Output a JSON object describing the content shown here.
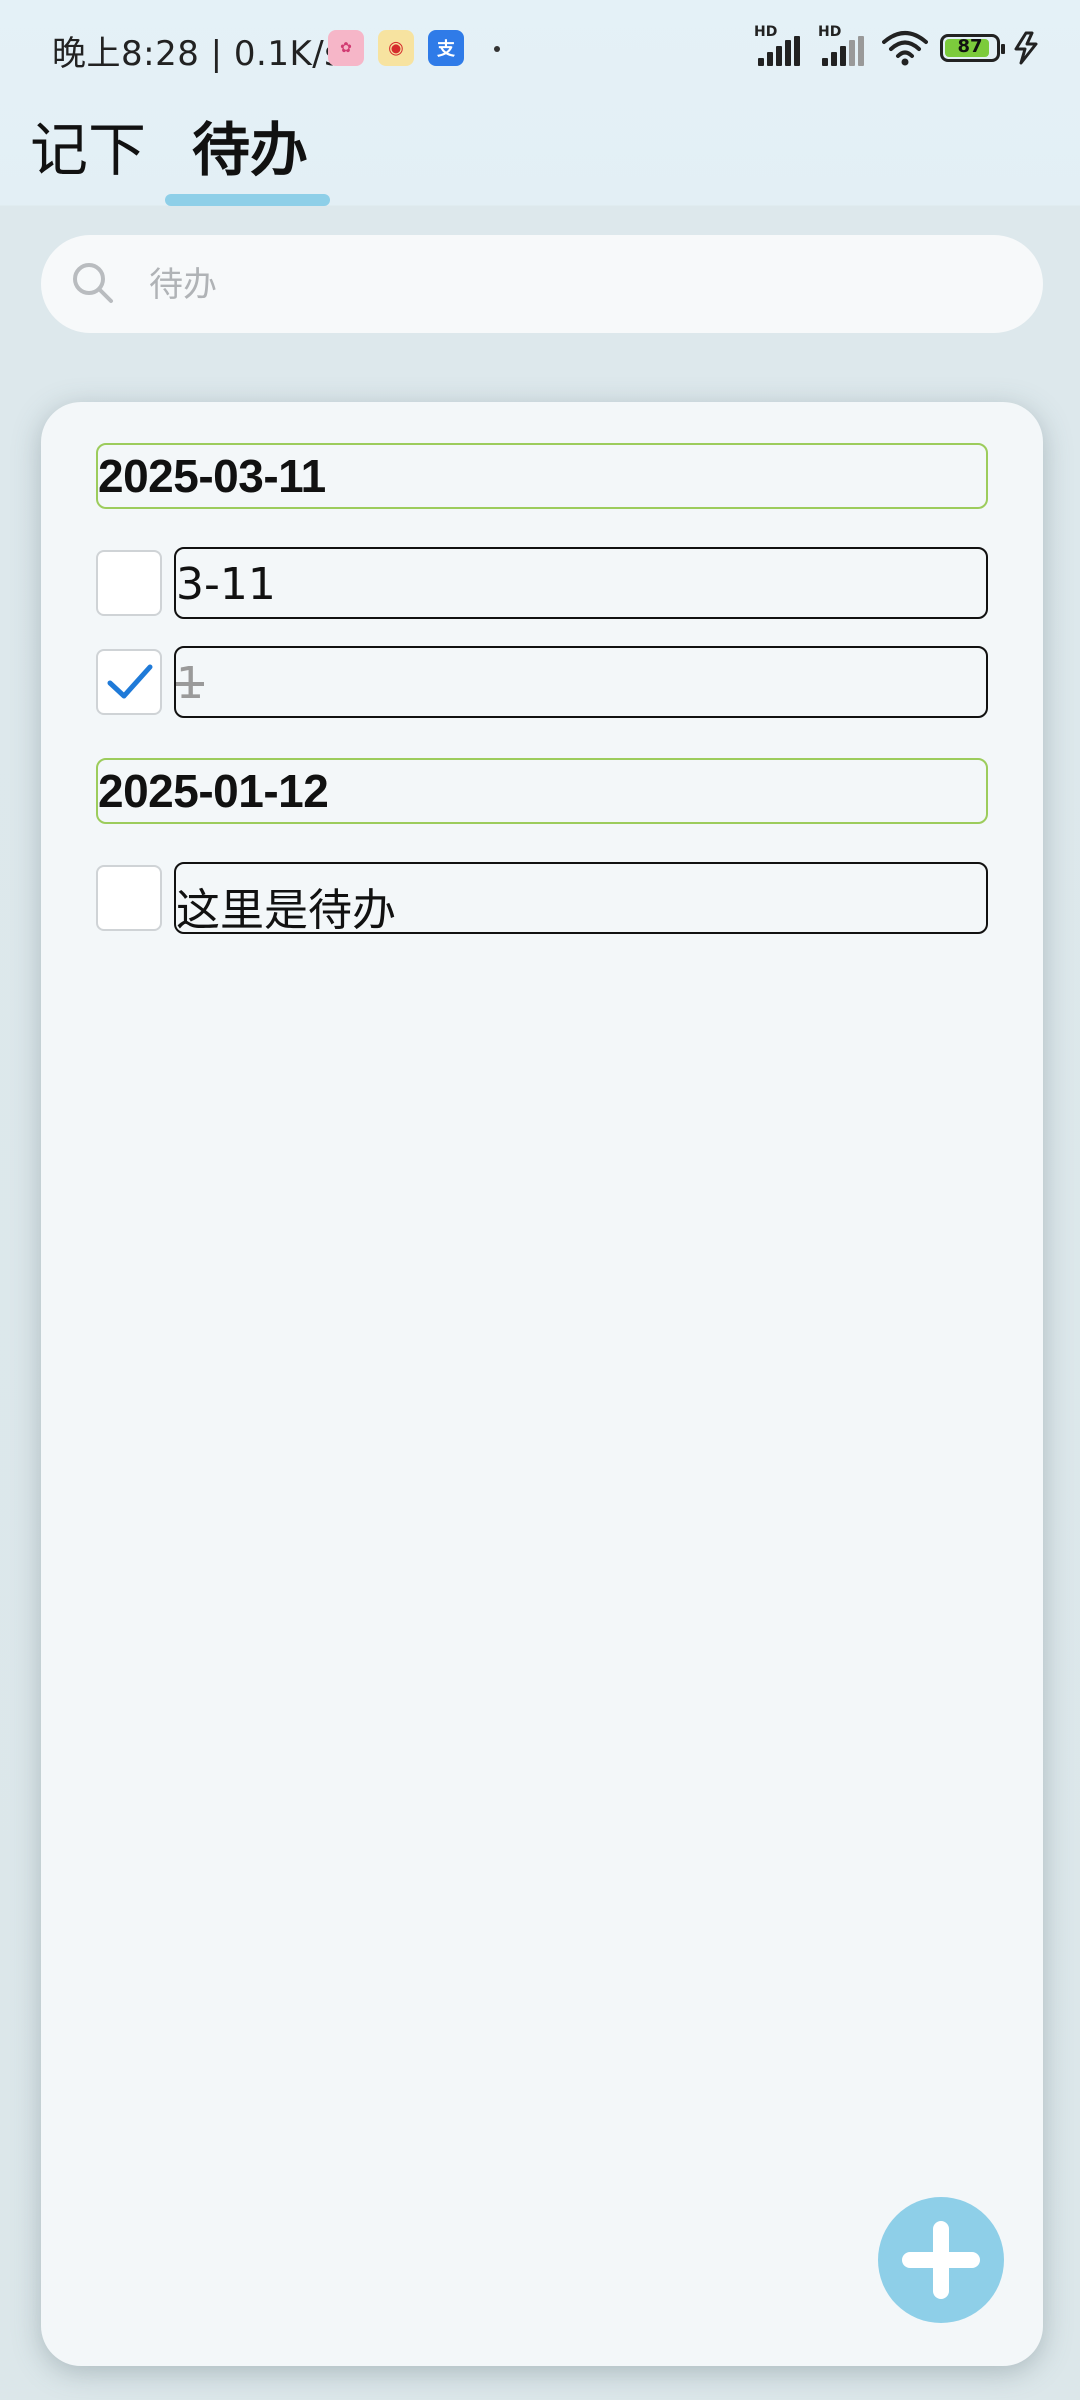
{
  "status_bar": {
    "time_speed": "晚上8:28 | 0.1K/s",
    "network_label_1": "HD",
    "network_label_2": "HD",
    "battery_level": "87",
    "icons": [
      "pink-app-icon",
      "weibo-icon",
      "alipay-icon",
      "dot",
      "signal-icon",
      "signal-icon",
      "wifi-icon",
      "battery-icon",
      "charging-icon"
    ]
  },
  "tabs": [
    {
      "label": "记下",
      "active": false
    },
    {
      "label": "待办",
      "active": true
    }
  ],
  "search": {
    "placeholder": "待办",
    "value": ""
  },
  "todo_groups": [
    {
      "date": "2025-03-11",
      "items": [
        {
          "text": "3-11",
          "checked": false
        },
        {
          "text": "1",
          "checked": true
        }
      ]
    },
    {
      "date": "2025-01-12",
      "items": [
        {
          "text": "这里是待办",
          "checked": false
        }
      ]
    }
  ],
  "fab": {
    "icon": "plus-icon"
  },
  "colors": {
    "accent": "#8ecfe8",
    "date_border": "#9ccc5c",
    "check": "#1f7ad8",
    "card_background": "#f3f7f9"
  }
}
